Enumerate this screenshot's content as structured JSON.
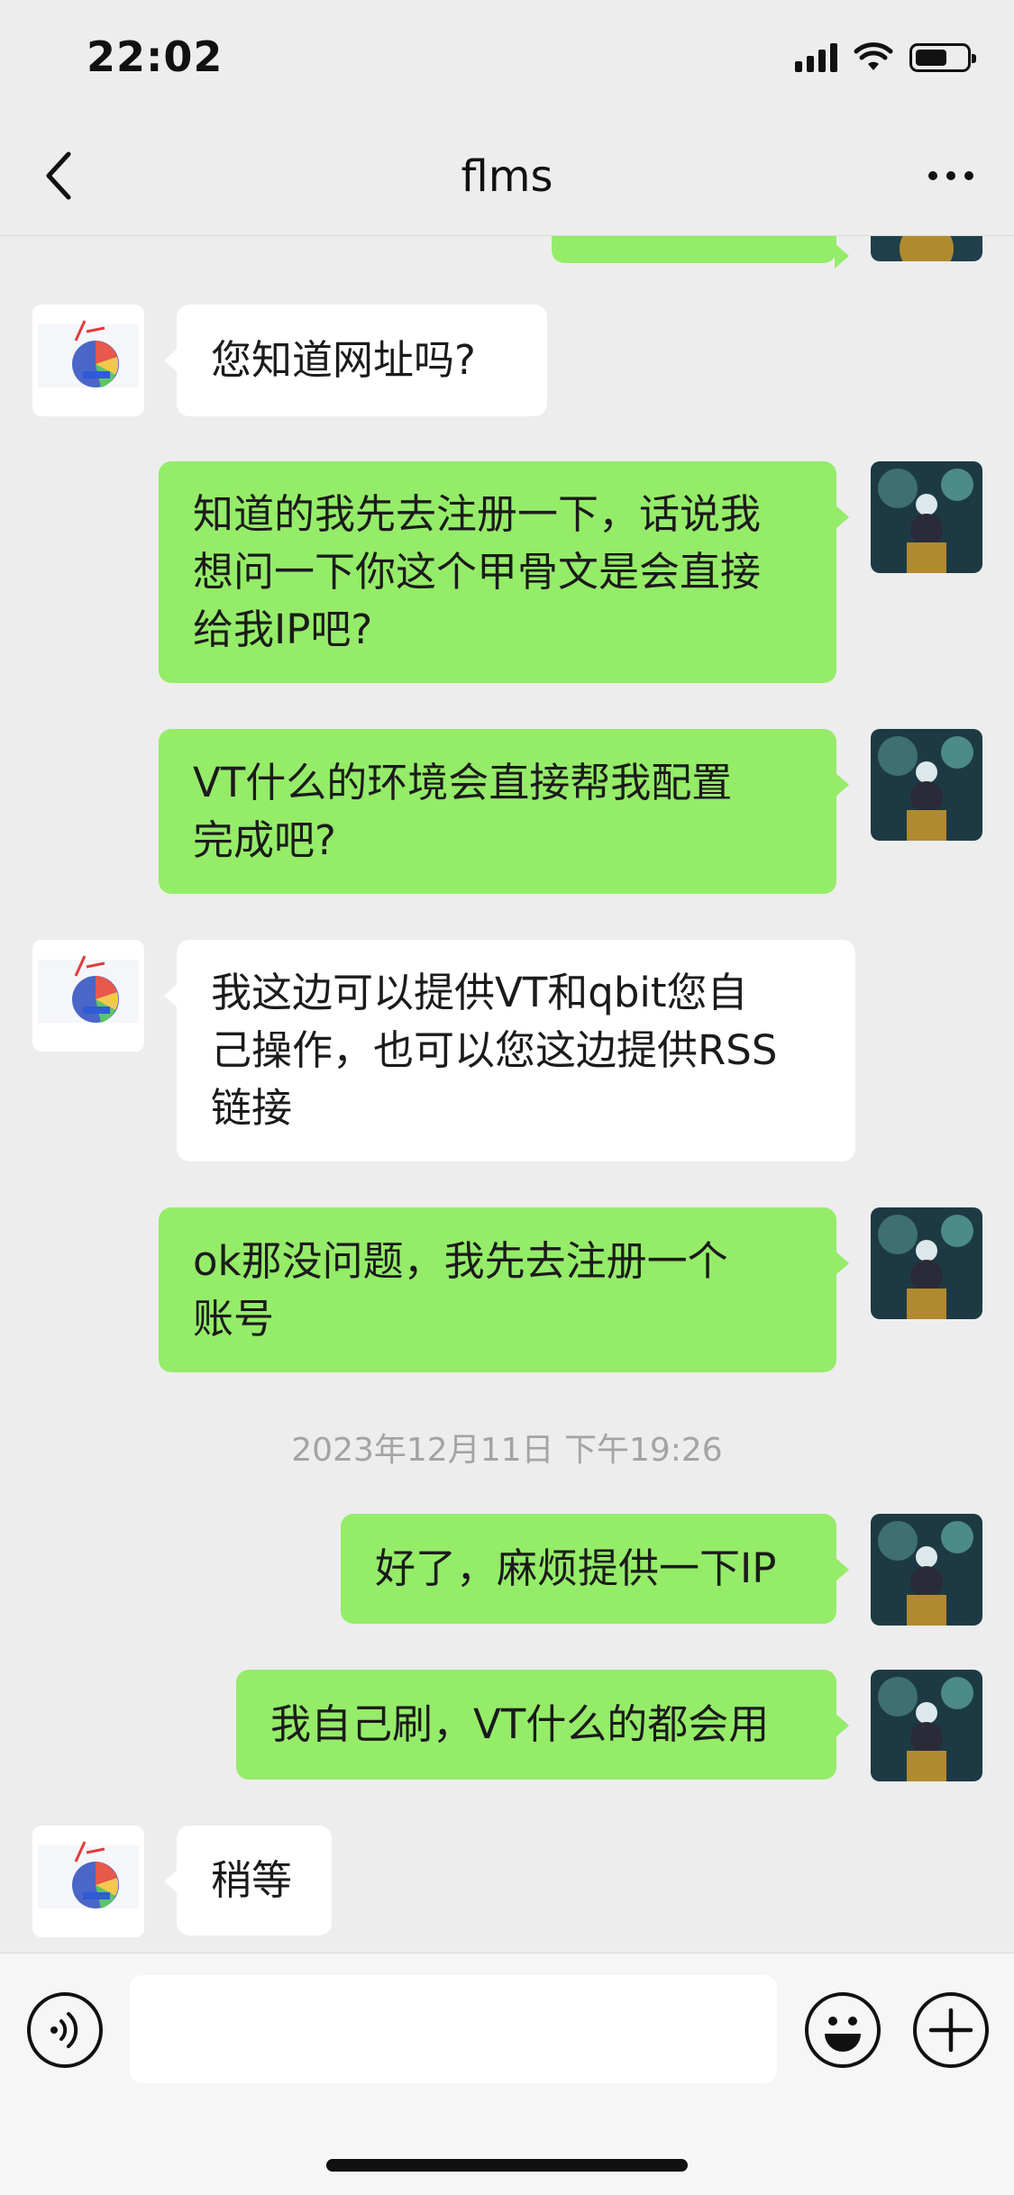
{
  "status_bar": {
    "time": "22:02"
  },
  "nav": {
    "title": "flms"
  },
  "messages": [
    {
      "side": "in",
      "text": "您知道网址吗?"
    },
    {
      "side": "out",
      "text": "知道的我先去注册一下，话说我\n想问一下你这个甲骨文是会直接\n给我IP吧?"
    },
    {
      "side": "out",
      "text": "VT什么的环境会直接帮我配置\n完成吧?"
    },
    {
      "side": "in",
      "text": "我这边可以提供VT和qbit您自\n己操作，也可以您这边提供RSS\n链接"
    },
    {
      "side": "out",
      "text": "ok那没问题，我先去注册一个\n账号"
    },
    {
      "side": "out",
      "text": "好了，麻烦提供一下IP"
    },
    {
      "side": "out",
      "text": "我自己刷，VT什么的都会用"
    },
    {
      "side": "in",
      "text": "稍等"
    }
  ],
  "timestamp": "2023年12月11日 下午19:26",
  "input": {
    "placeholder": ""
  },
  "colors": {
    "outgoing_bubble": "#95ec69",
    "incoming_bubble": "#ffffff",
    "background": "#ededed"
  }
}
